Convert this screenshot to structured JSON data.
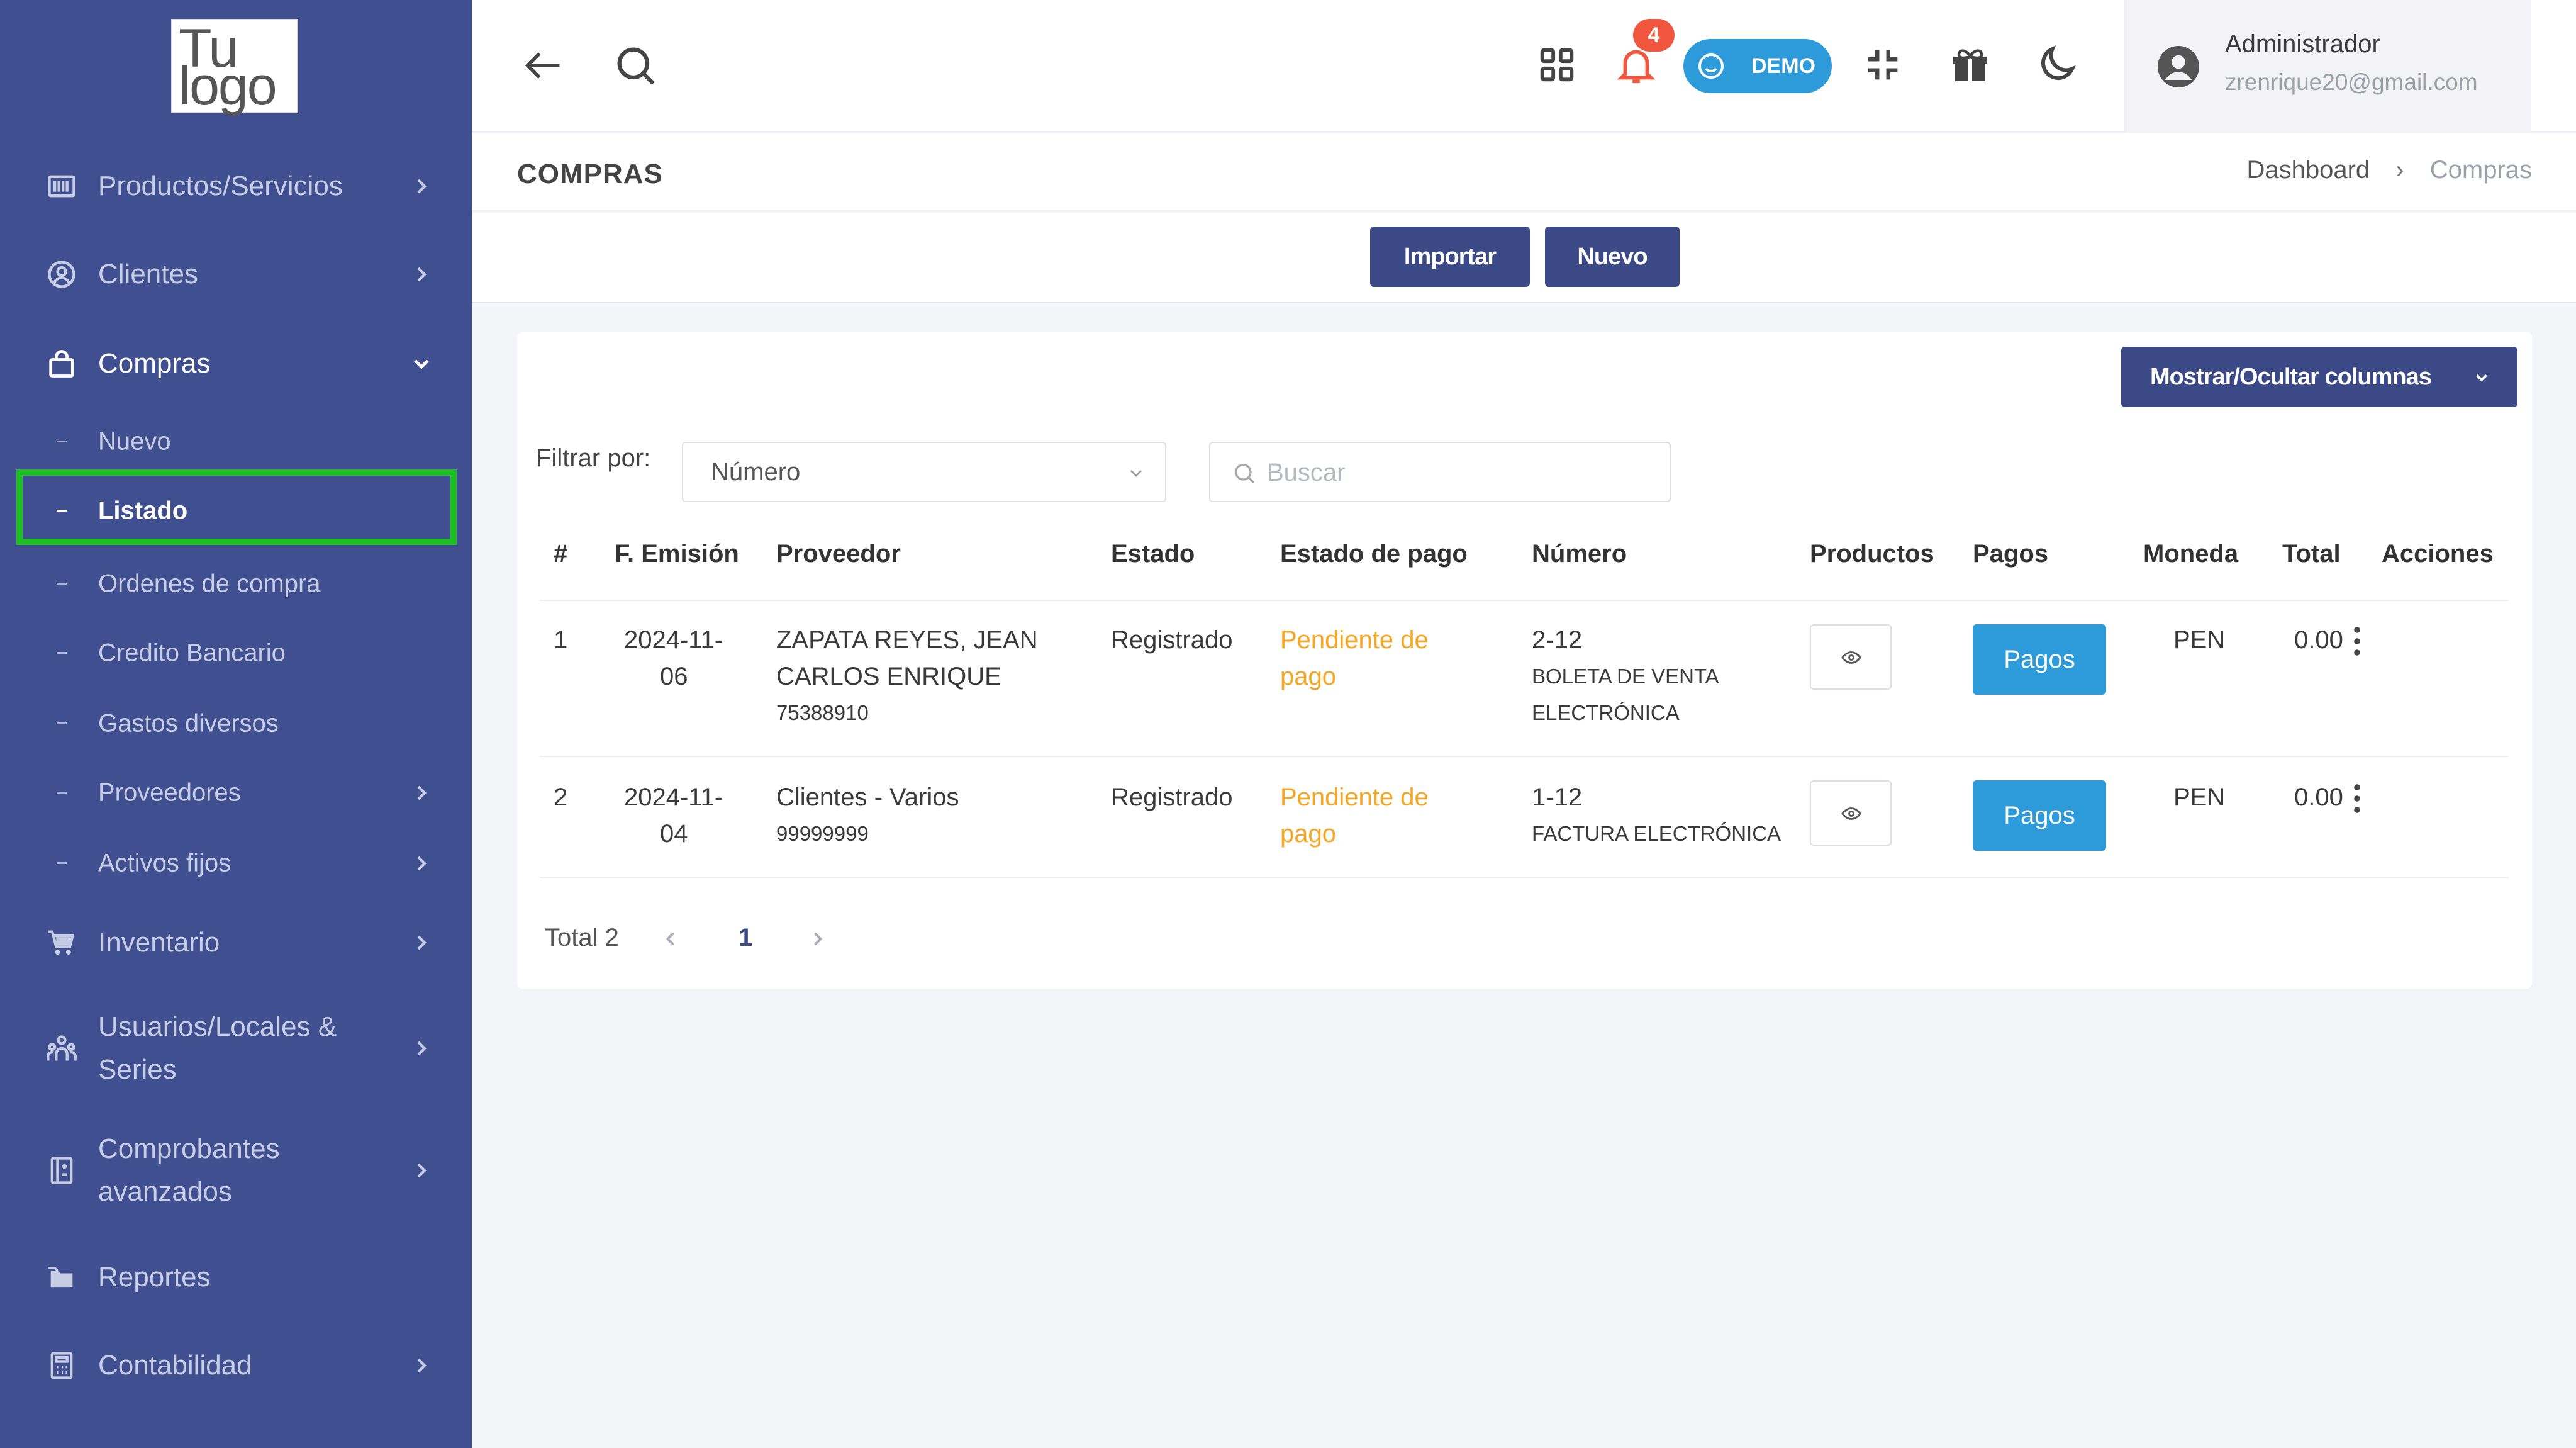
{
  "logo": {
    "line1": "Tu",
    "line2": "logo"
  },
  "sidebar": {
    "items": [
      {
        "label": "Productos/Servicios",
        "icon": "barcode-icon"
      },
      {
        "label": "Clientes",
        "icon": "user-circle-icon"
      },
      {
        "label": "Compras",
        "icon": "shopping-bag-icon"
      },
      {
        "label": "Inventario",
        "icon": "cart-icon"
      },
      {
        "label": "Usuarios/Locales & Series",
        "icon": "users-icon"
      },
      {
        "label": "Comprobantes avanzados",
        "icon": "receipt-icon"
      },
      {
        "label": "Reportes",
        "icon": "folders-icon"
      },
      {
        "label": "Contabilidad",
        "icon": "calculator-icon"
      }
    ],
    "compras_sub": [
      {
        "label": "Nuevo"
      },
      {
        "label": "Listado"
      },
      {
        "label": "Ordenes de compra"
      },
      {
        "label": "Credito Bancario"
      },
      {
        "label": "Gastos diversos"
      },
      {
        "label": "Proveedores"
      },
      {
        "label": "Activos fijos"
      }
    ]
  },
  "topbar": {
    "notification_count": "4",
    "demo_label": "DEMO",
    "user": {
      "name": "Administrador",
      "email": "zrenrique20@gmail.com"
    }
  },
  "header": {
    "title": "COMPRAS",
    "breadcrumb": {
      "root": "Dashboard",
      "separator": "›",
      "current": "Compras"
    }
  },
  "actions": {
    "import_label": "Importar",
    "new_label": "Nuevo"
  },
  "table_tools": {
    "columns_toggle_label": "Mostrar/Ocultar columnas",
    "filter_label": "Filtrar por:",
    "filter_value": "Número",
    "search_placeholder": "Buscar"
  },
  "table": {
    "headers": {
      "idx": "#",
      "fecha": "F. Emisión",
      "proveedor": "Proveedor",
      "estado": "Estado",
      "estado_pago": "Estado de pago",
      "numero": "Número",
      "productos": "Productos",
      "pagos": "Pagos",
      "moneda": "Moneda",
      "total": "Total",
      "acciones": "Acciones"
    },
    "rows": [
      {
        "idx": "1",
        "fecha_l1": "2024-11-",
        "fecha_l2": "06",
        "proveedor_l1": "ZAPATA REYES, JEAN",
        "proveedor_l2": "CARLOS ENRIQUE",
        "proveedor_doc": "75388910",
        "estado": "Registrado",
        "estado_pago_l1": "Pendiente de",
        "estado_pago_l2": "pago",
        "numero": "2-12",
        "tipo_l1": "BOLETA DE VENTA",
        "tipo_l2": "ELECTRÓNICA",
        "pagos_label": "Pagos",
        "moneda": "PEN",
        "total": "0.00"
      },
      {
        "idx": "2",
        "fecha_l1": "2024-11-",
        "fecha_l2": "04",
        "proveedor_l1": "Clientes - Varios",
        "proveedor_doc": "99999999",
        "estado": "Registrado",
        "estado_pago_l1": "Pendiente de",
        "estado_pago_l2": "pago",
        "numero": "1-12",
        "tipo_l1": "FACTURA ELECTRÓNICA",
        "pagos_label": "Pagos",
        "moneda": "PEN",
        "total": "0.00"
      }
    ]
  },
  "pagination": {
    "total_label": "Total 2",
    "current_page": "1"
  },
  "colors": {
    "sidebar_bg": "#3f4f8f",
    "primary_button": "#3b4a86",
    "accent_blue": "#2d9bd9",
    "pending_orange": "#f5a623",
    "badge_red": "#f0573e",
    "selection_outline": "#1fbf23"
  }
}
